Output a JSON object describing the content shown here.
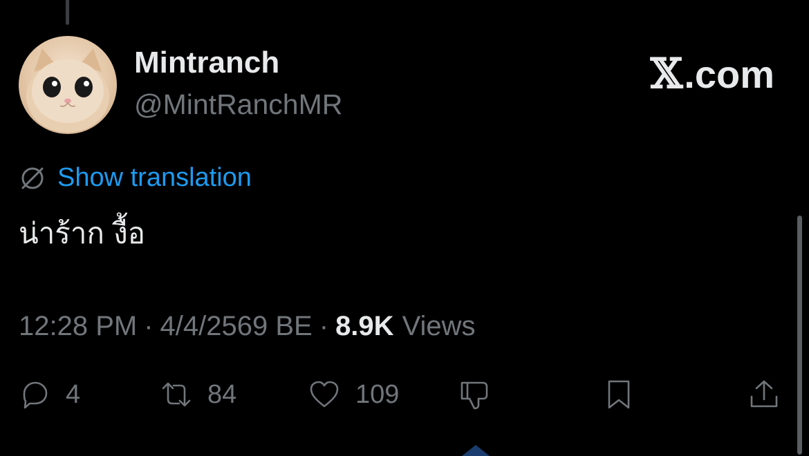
{
  "colors": {
    "background": "#000000",
    "text": "#e7e9ea",
    "muted": "#71767b",
    "link": "#1d9bf0"
  },
  "author": {
    "display_name": "Mintranch",
    "handle": "@MintRanchMR",
    "avatar_icon": "cat-avatar-icon"
  },
  "brand": {
    "x_glyph": "𝕏",
    "text": ".com"
  },
  "translation": {
    "icon": "globe-icon",
    "label": "Show translation"
  },
  "tweet": {
    "text": "น่าร้าก งื้อ"
  },
  "meta": {
    "time": "12:28 PM",
    "sep1": "·",
    "date": "4/4/2569 BE",
    "sep2": "·",
    "views_count": "8.9K",
    "views_label": "Views"
  },
  "actions": {
    "reply": {
      "icon": "reply-icon",
      "count": "4"
    },
    "repost": {
      "icon": "repost-icon",
      "count": "84"
    },
    "like": {
      "icon": "heart-icon",
      "count": "109"
    },
    "dislike": {
      "icon": "thumbs-down-icon"
    },
    "bookmark": {
      "icon": "bookmark-icon"
    },
    "share": {
      "icon": "share-icon"
    }
  }
}
